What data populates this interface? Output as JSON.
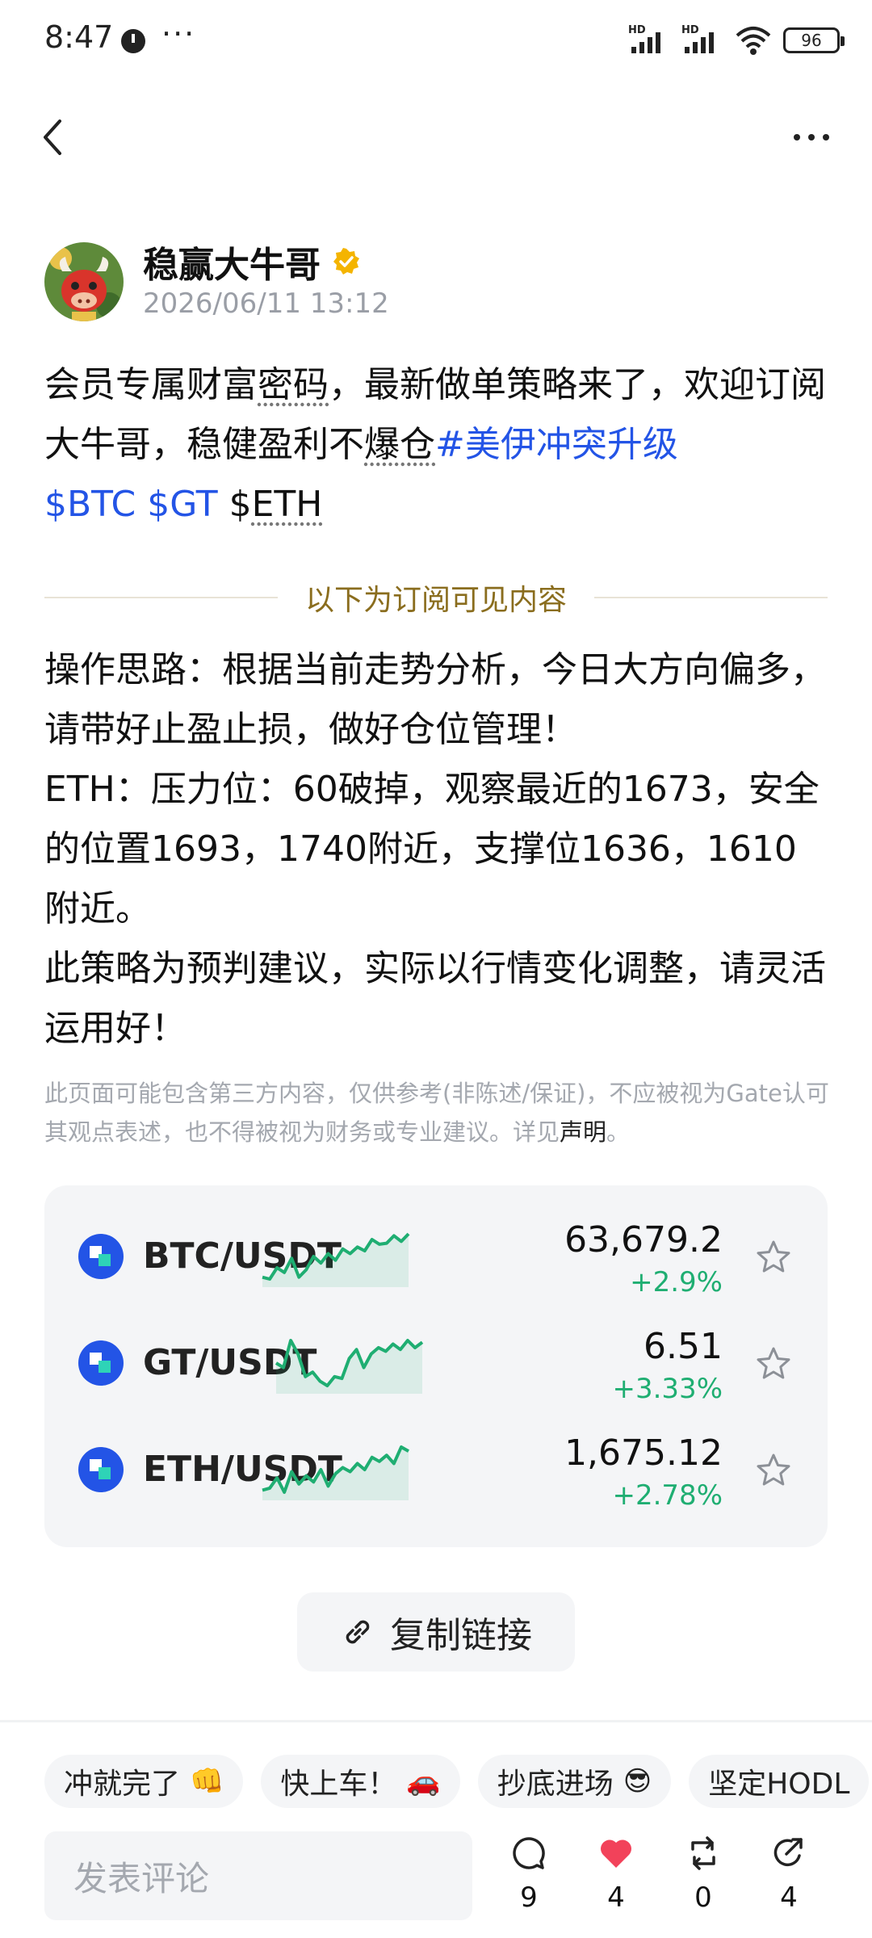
{
  "status": {
    "time": "8:47",
    "dots": "···",
    "signal_label_1": "HD",
    "signal_label_2": "HD",
    "battery": "96"
  },
  "author": {
    "name": "稳赢大牛哥",
    "timestamp": "2026/06/11 13:12"
  },
  "post": {
    "text_1": "会员专属财富",
    "text_underlined_1": "密码",
    "text_2": "，最新做单策略来了，欢迎订阅大牛哥，稳健盈利不",
    "text_underlined_2": "爆仓",
    "hashtag": "#美伊冲突升级",
    "ticker_btc": "$BTC",
    "ticker_gt": "$GT",
    "ticker_eth_prefix": "$",
    "ticker_eth_name": "ETH"
  },
  "divider_text": "以下为订阅可见内容",
  "body": {
    "paragraphs": [
      "操作思路：根据当前走势分析，今日大方向偏多，请带好止盈止损，做好仓位管理！",
      "ETH：压力位：60破掉，观察最近的1673，安全的位置1693，1740附近，支撑位1636，1610附近。",
      "此策略为预判建议，实际以行情变化调整，请灵活运用好！"
    ]
  },
  "disclaimer": {
    "text": "此页面可能包含第三方内容，仅供参考(非陈述/保证)，不应被视为Gate认可其观点表述，也不得被视为财务或专业建议。详见",
    "link": "声明",
    "end": "。"
  },
  "markets": [
    {
      "pair": "BTC/USDT",
      "price": "63,679.2",
      "change": "+2.9%",
      "spark": [
        30,
        28,
        40,
        35,
        50,
        30,
        38,
        52,
        45,
        55,
        48,
        60,
        55,
        62,
        58,
        70,
        65,
        66,
        74,
        68,
        76
      ]
    },
    {
      "pair": "GT/USDT",
      "price": "6.51",
      "change": "+3.33%",
      "spark": [
        45,
        40,
        70,
        55,
        30,
        35,
        25,
        20,
        30,
        28,
        50,
        60,
        40,
        55,
        62,
        58,
        66,
        60,
        70,
        62,
        68
      ]
    },
    {
      "pair": "ETH/USDT",
      "price": "1,675.12",
      "change": "+2.78%",
      "spark": [
        30,
        32,
        42,
        28,
        48,
        36,
        44,
        38,
        50,
        34,
        46,
        52,
        48,
        56,
        50,
        62,
        58,
        64,
        56,
        72,
        68
      ]
    }
  ],
  "colors": {
    "accent": "#2354e6",
    "positive": "#1fae72",
    "divider_text": "#8a6d1e",
    "verified": "#f4b400"
  },
  "copy_link": "复制链接",
  "chips": [
    {
      "label": "冲就完了",
      "emoji": "👊"
    },
    {
      "label": "快上车！",
      "emoji": "🚗"
    },
    {
      "label": "抄底进场",
      "emoji": "😎"
    },
    {
      "label": "坚定HODL",
      "emoji": ""
    }
  ],
  "comment_placeholder": "发表评论",
  "actions": {
    "comments": "9",
    "likes": "4",
    "reposts": "0",
    "shares": "4"
  }
}
